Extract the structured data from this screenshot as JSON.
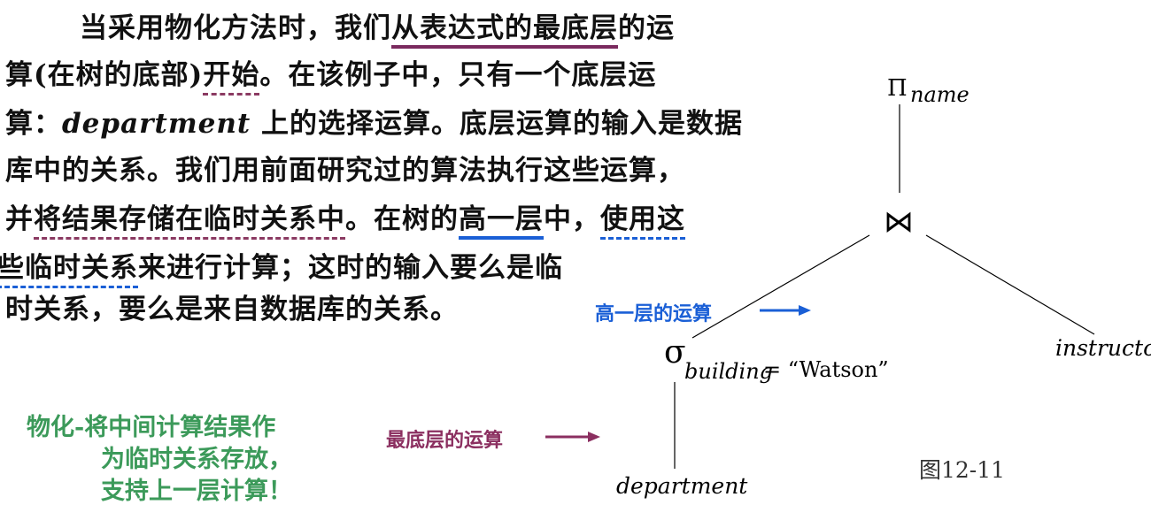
{
  "paragraph": {
    "l1a": "当采用物化方法时，我们",
    "l1b": "从表达式的最底层",
    "l1c": "的运",
    "l2a": "算(在树的底部)",
    "l2b": "开始",
    "l2c": "。在该例子中，只有一个底层运",
    "l3a": "算：",
    "l3b": "department",
    "l3c": " 上的选择运算。底层运算的输入是数据",
    "l4": "库中的关系。我们用前面研究过的算法执行这些运算，",
    "l5a": "并",
    "l5b": "将结果存储在临时关系中",
    "l5c": "。在树的",
    "l5d": "高一层",
    "l5e": "中，",
    "l5f": "使用这",
    "l6a": "些临时关系",
    "l6b": "来进行计算；这时的输入要么是临",
    "l7": "时关系，要么是来自数据库的关系。"
  },
  "tree": {
    "pi_symbol": "Π",
    "pi_subscript": "name",
    "join_symbol": "⋈",
    "sigma_symbol": "σ",
    "sigma_subscript": "building",
    "sigma_condition": " = “Watson”",
    "leaf_left": "department",
    "leaf_right": "instructor"
  },
  "annotations": {
    "higher_level": "高一层的运算",
    "lowest_level": "最底层的运算"
  },
  "note": {
    "line1": "物化-将中间计算结果作",
    "line2": "为临时关系存放，",
    "line3": "支持上一层计算！"
  },
  "figure_label": "图12-11",
  "colors": {
    "higher_level": "#1a5fd6",
    "lowest_level": "#8b2f60",
    "note": "#3c9a5a"
  }
}
